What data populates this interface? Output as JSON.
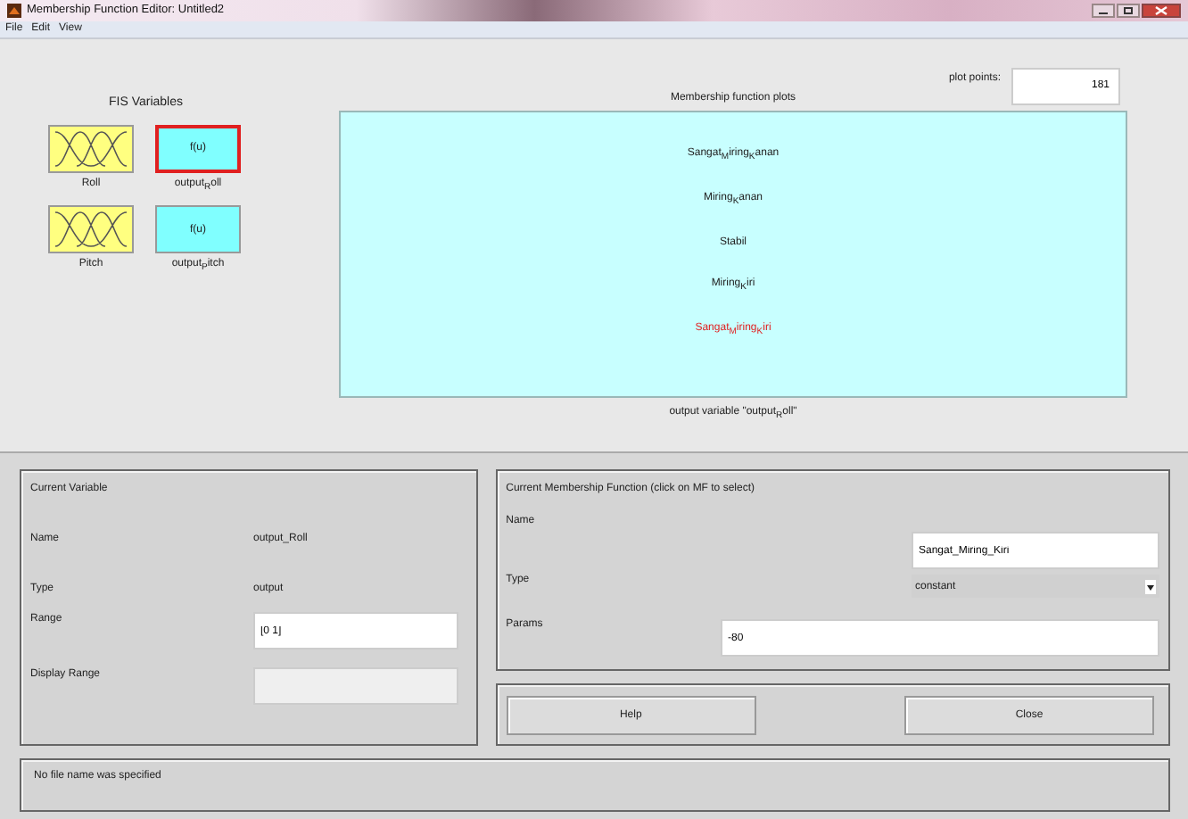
{
  "window": {
    "title": "Membership Function Editor: Untitled2"
  },
  "menu": [
    "File",
    "Edit",
    "View"
  ],
  "fis_variables": {
    "title": "FIS Variables",
    "items": [
      {
        "kind": "input",
        "label": "Roll",
        "selected": false
      },
      {
        "kind": "output",
        "label": "output$_{R}$oll",
        "symbol": "f(u)",
        "selected": true
      },
      {
        "kind": "input",
        "label": "Pitch",
        "selected": false
      },
      {
        "kind": "output",
        "label": "output$_{P}$itch",
        "symbol": "f(u)",
        "selected": false
      }
    ]
  },
  "plot": {
    "title": "Membership function plots",
    "plot_points_label": "plot points:",
    "plot_points": "181",
    "mfs": [
      {
        "label": "Sangat$_{M}$iring$_{K}$anan",
        "selected": false
      },
      {
        "label": "Miring$_{K}$anan",
        "selected": false
      },
      {
        "label": "Stabil",
        "selected": false
      },
      {
        "label": "Miring$_{K}$iri",
        "selected": false
      },
      {
        "label": "Sangat$_{M}$iring$_{K}$iri",
        "selected": true
      }
    ],
    "caption": "output variable \"output$_{R}$oll\""
  },
  "current_variable": {
    "title": "Current Variable",
    "rows": [
      {
        "kind": "text",
        "label": "Name",
        "value": "output_Roll"
      },
      {
        "kind": "text",
        "label": "Type",
        "value": "output"
      },
      {
        "kind": "field",
        "label": "Range",
        "value": "[0 1]",
        "disabled": false
      },
      {
        "kind": "field",
        "label": "Display Range",
        "disabled": true
      }
    ]
  },
  "current_mf": {
    "title": "Current Membership Function (click on MF to select)",
    "name_label": "Name",
    "name": "Sangat_Miring_Kiri",
    "type_label": "Type",
    "type": "constant",
    "params_label": "Params",
    "params": "-80"
  },
  "buttons": [
    "Help",
    "Close"
  ],
  "status": "No file name was specified"
}
